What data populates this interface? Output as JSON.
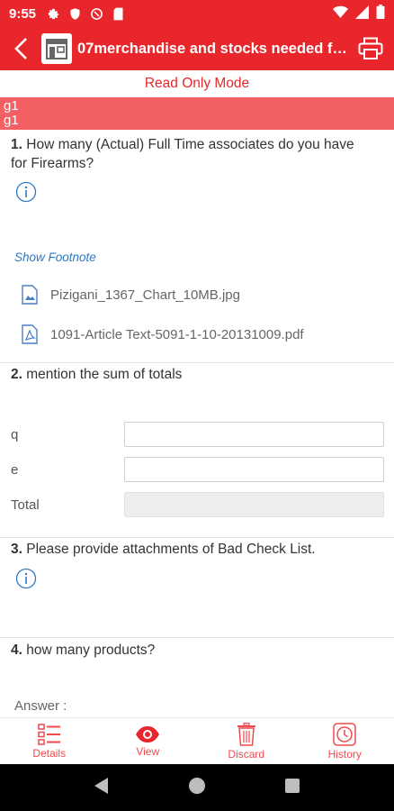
{
  "status_bar": {
    "time": "9:55"
  },
  "app_bar": {
    "title": "07merchandise and stocks needed fo..."
  },
  "mode_label": "Read Only Mode",
  "group": {
    "line1": "g1",
    "line2": "g1"
  },
  "questions": [
    {
      "number": "1.",
      "text_line1": "How many (Actual) Full Time associates do you have",
      "text_line2": "for Firearms?"
    },
    {
      "number": "2.",
      "text": "mention the sum of totals"
    },
    {
      "number": "3.",
      "text": "Please provide attachments of Bad Check List."
    },
    {
      "number": "4.",
      "text": "how many products?"
    }
  ],
  "footnote_link": "Show Footnote",
  "attachments": [
    {
      "name": "Pizigani_1367_Chart_10MB.jpg",
      "icon": "image-file-icon"
    },
    {
      "name": "1091-Article Text-5091-1-10-20131009.pdf",
      "icon": "pdf-file-icon"
    }
  ],
  "sum_rows": [
    {
      "label": "q",
      "value": ""
    },
    {
      "label": "e",
      "value": ""
    },
    {
      "label": "Total",
      "value": ""
    }
  ],
  "answer_label": "Answer :",
  "bottom_nav": [
    {
      "label": "Details",
      "icon": "list-icon"
    },
    {
      "label": "View",
      "icon": "eye-icon"
    },
    {
      "label": "Discard",
      "icon": "trash-icon"
    },
    {
      "label": "History",
      "icon": "clock-icon"
    }
  ],
  "colors": {
    "primary": "#e8262b",
    "group_header": "#f26063",
    "link": "#2f78c4"
  }
}
